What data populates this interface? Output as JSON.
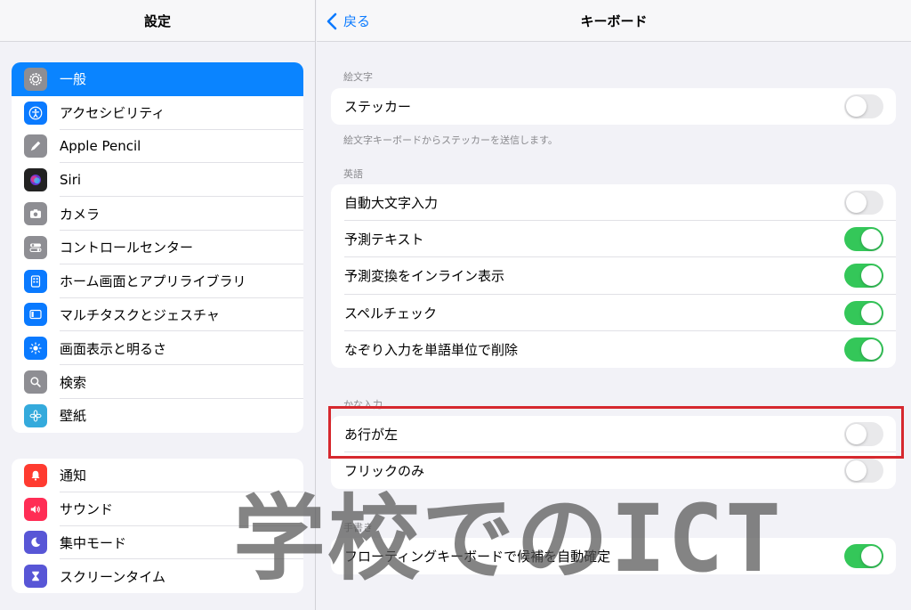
{
  "sidebar": {
    "title": "設定",
    "group1": [
      {
        "label": "一般",
        "icon": "gear-icon",
        "color": "#8e8e93",
        "selected": true
      },
      {
        "label": "アクセシビリティ",
        "icon": "accessibility-icon",
        "color": "#0a7aff"
      },
      {
        "label": "Apple Pencil",
        "icon": "pencil-icon",
        "color": "#8e8e93"
      },
      {
        "label": "Siri",
        "icon": "siri-icon",
        "color": "#222222"
      },
      {
        "label": "カメラ",
        "icon": "camera-icon",
        "color": "#8e8e93"
      },
      {
        "label": "コントロールセンター",
        "icon": "control-center-icon",
        "color": "#8e8e93"
      },
      {
        "label": "ホーム画面とアプリライブラリ",
        "icon": "home-screen-icon",
        "color": "#0a7aff"
      },
      {
        "label": "マルチタスクとジェスチャ",
        "icon": "multitasking-icon",
        "color": "#0a7aff"
      },
      {
        "label": "画面表示と明るさ",
        "icon": "brightness-icon",
        "color": "#0a7aff"
      },
      {
        "label": "検索",
        "icon": "search-icon",
        "color": "#8e8e93"
      },
      {
        "label": "壁紙",
        "icon": "wallpaper-icon",
        "color": "#34aadc"
      }
    ],
    "group2": [
      {
        "label": "通知",
        "icon": "notification-icon",
        "color": "#ff3b30"
      },
      {
        "label": "サウンド",
        "icon": "sound-icon",
        "color": "#ff2d55"
      },
      {
        "label": "集中モード",
        "icon": "moon-icon",
        "color": "#5856d6"
      },
      {
        "label": "スクリーンタイム",
        "icon": "hourglass-icon",
        "color": "#5856d6"
      }
    ]
  },
  "header": {
    "back_label": "戻る",
    "title": "キーボード"
  },
  "sections": {
    "emoji": {
      "header": "絵文字",
      "rows": [
        {
          "label": "ステッカー",
          "on": false
        }
      ],
      "footer": "絵文字キーボードからステッカーを送信します。"
    },
    "english": {
      "header": "英語",
      "rows": [
        {
          "label": "自動大文字入力",
          "on": false
        },
        {
          "label": "予測テキスト",
          "on": true
        },
        {
          "label": "予測変換をインライン表示",
          "on": true
        },
        {
          "label": "スペルチェック",
          "on": true
        },
        {
          "label": "なぞり入力を単語単位で削除",
          "on": true
        }
      ]
    },
    "kana": {
      "header": "かな入力",
      "rows": [
        {
          "label": "あ行が左",
          "on": false
        },
        {
          "label": "フリックのみ",
          "on": false
        }
      ]
    },
    "handwriting": {
      "header": "手書き",
      "rows": [
        {
          "label": "フローティングキーボードで候補を自動確定",
          "on": true
        }
      ]
    }
  },
  "watermark": "学校でのICT",
  "colors": {
    "accent": "#0a84ff",
    "toggle_on": "#34c759",
    "highlight": "#d6282e"
  }
}
